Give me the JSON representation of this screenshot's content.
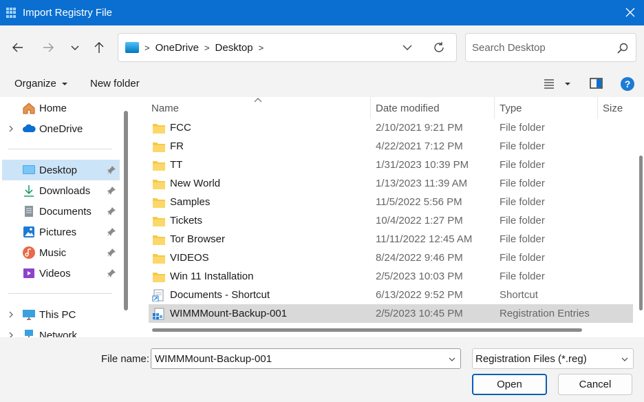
{
  "window": {
    "title": "Import Registry File"
  },
  "address": {
    "crumbs": [
      "OneDrive",
      "Desktop"
    ]
  },
  "search": {
    "placeholder": "Search Desktop"
  },
  "toolbar": {
    "organize": "Organize",
    "new_folder": "New folder"
  },
  "sidebar": {
    "quick": [
      {
        "label": "Home",
        "icon": "home-icon"
      },
      {
        "label": "OneDrive",
        "icon": "cloud-icon",
        "expandable": true
      }
    ],
    "pinned": [
      {
        "label": "Desktop",
        "icon": "desktop-icon",
        "selected": true
      },
      {
        "label": "Downloads",
        "icon": "download-icon"
      },
      {
        "label": "Documents",
        "icon": "documents-icon"
      },
      {
        "label": "Pictures",
        "icon": "pictures-icon"
      },
      {
        "label": "Music",
        "icon": "music-icon"
      },
      {
        "label": "Videos",
        "icon": "videos-icon"
      }
    ],
    "devices": [
      {
        "label": "This PC",
        "icon": "computer-icon"
      },
      {
        "label": "Network",
        "icon": "network-icon"
      }
    ]
  },
  "columns": {
    "name": "Name",
    "date": "Date modified",
    "type": "Type",
    "size": "Size"
  },
  "files": [
    {
      "name": "FCC",
      "date": "2/10/2021 9:21 PM",
      "type": "File folder",
      "icon": "folder-icon"
    },
    {
      "name": "FR",
      "date": "4/22/2021 7:12 PM",
      "type": "File folder",
      "icon": "folder-icon"
    },
    {
      "name": "TT",
      "date": "1/31/2023 10:39 PM",
      "type": "File folder",
      "icon": "folder-icon"
    },
    {
      "name": "New World",
      "date": "1/13/2023 11:39 AM",
      "type": "File folder",
      "icon": "folder-icon"
    },
    {
      "name": "Samples",
      "date": "11/5/2022 5:56 PM",
      "type": "File folder",
      "icon": "folder-icon"
    },
    {
      "name": "Tickets",
      "date": "10/4/2022 1:27 PM",
      "type": "File folder",
      "icon": "folder-icon"
    },
    {
      "name": "Tor Browser",
      "date": "11/11/2022 12:45 AM",
      "type": "File folder",
      "icon": "folder-icon"
    },
    {
      "name": "VIDEOS",
      "date": "8/24/2022 9:46 PM",
      "type": "File folder",
      "icon": "folder-icon"
    },
    {
      "name": "Win 11 Installation",
      "date": "2/5/2023 10:03 PM",
      "type": "File folder",
      "icon": "folder-icon"
    },
    {
      "name": "Documents - Shortcut",
      "date": "6/13/2022 9:52 PM",
      "type": "Shortcut",
      "icon": "shortcut-icon"
    },
    {
      "name": "WIMMMount-Backup-001",
      "date": "2/5/2023 10:45 PM",
      "type": "Registration Entries",
      "icon": "registry-file-icon",
      "selected": true
    }
  ],
  "footer": {
    "file_name_label": "File name:",
    "file_name_value": "WIMMMount-Backup-001",
    "file_type": "Registration Files (*.reg)",
    "open_label": "Open",
    "cancel_label": "Cancel"
  },
  "colors": {
    "titlebar": "#0a6fd0",
    "selection": "#cce4f7",
    "folder": "#f7c948"
  }
}
